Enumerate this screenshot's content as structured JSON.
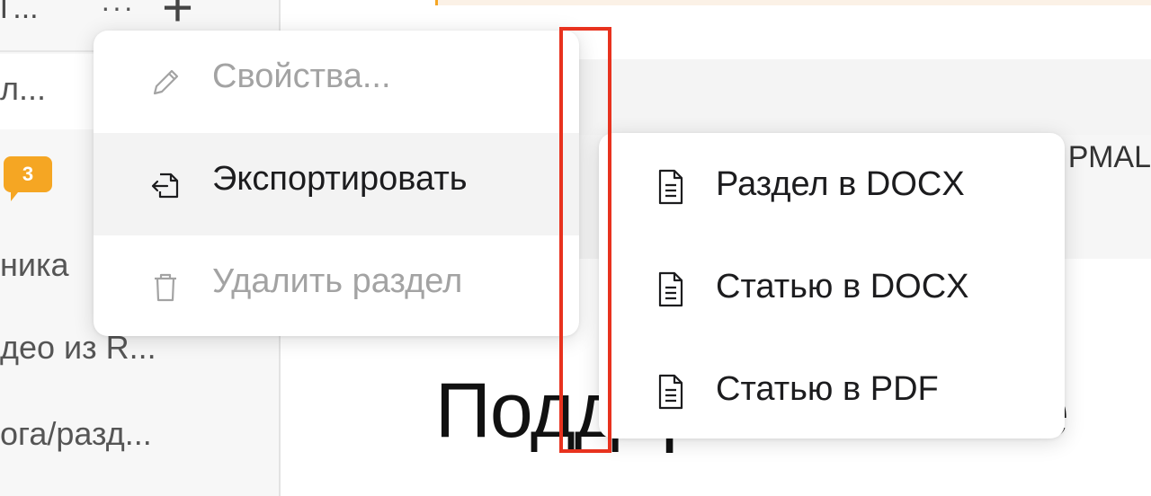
{
  "sidebar": {
    "top_label": "Г...",
    "more_icon": "more-horizontal-icon",
    "add_icon": "plus-icon",
    "items": [
      {
        "label": "л..."
      },
      {
        "badge": "3"
      },
      {
        "label": "ника"
      },
      {
        "label": "део из R..."
      },
      {
        "label": "ога/разд..."
      }
    ]
  },
  "main": {
    "side_text": "РМАL",
    "title": "Поддерживаемые"
  },
  "context_menu": {
    "items": [
      {
        "label": "Свойства...",
        "icon": "pencil-icon",
        "disabled": true
      },
      {
        "label": "Экспортировать",
        "icon": "export-icon",
        "disabled": false,
        "highlighted": true
      },
      {
        "label": "Удалить раздел",
        "icon": "trash-icon",
        "disabled": true
      }
    ]
  },
  "export_submenu": {
    "items": [
      {
        "label": "Раздел в DOCX",
        "icon": "document-icon"
      },
      {
        "label": "Статью в DOCX",
        "icon": "document-icon"
      },
      {
        "label": "Статью в PDF",
        "icon": "document-icon"
      }
    ]
  },
  "colors": {
    "accent": "#f5a623",
    "annotation": "#e8321e",
    "disabled_text": "#a3a3a3"
  }
}
